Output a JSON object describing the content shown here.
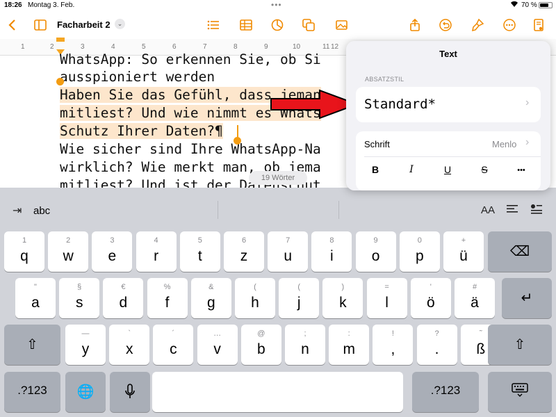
{
  "status": {
    "time": "18:26",
    "date": "Montag 3. Feb.",
    "battery": "70 %"
  },
  "toolbar": {
    "doc_title": "Facharbeit 2",
    "title_menu": "⌄"
  },
  "ruler": {
    "numbers": [
      "1",
      "2",
      "3",
      "4",
      "5",
      "6",
      "7",
      "8",
      "9",
      "10",
      "11",
      "12"
    ]
  },
  "document": {
    "lines": [
      "WhatsApp: So erkennen Sie, ob Si",
      "ausspioniert werden",
      "Haben Sie das Gefühl, dass jeman",
      "mitliest? Und wie nimmt es Whats",
      "Schutz Ihrer Daten?¶",
      "Wie sicher sind Ihre WhatsApp-Na",
      "wirklich? Wie merkt man, ob jema",
      "mitliest? Und ist der Datenschut"
    ],
    "word_count": "19 Wörter"
  },
  "panel": {
    "title": "Text",
    "section_label": "ABSATZSTIL",
    "paragraph_style": "Standard*",
    "font_label": "Schrift",
    "font_value": "Menlo",
    "format": {
      "bold": "B",
      "italic": "I",
      "underline": "U",
      "strike": "S",
      "more": "•••"
    }
  },
  "keyboard": {
    "suggest_left": "abc",
    "text_size": "AA",
    "row1": [
      {
        "main": "q",
        "sub": "1"
      },
      {
        "main": "w",
        "sub": "2"
      },
      {
        "main": "e",
        "sub": "3"
      },
      {
        "main": "r",
        "sub": "4"
      },
      {
        "main": "t",
        "sub": "5"
      },
      {
        "main": "z",
        "sub": "6"
      },
      {
        "main": "u",
        "sub": "7"
      },
      {
        "main": "i",
        "sub": "8"
      },
      {
        "main": "o",
        "sub": "9"
      },
      {
        "main": "p",
        "sub": "0"
      },
      {
        "main": "ü",
        "sub": "+"
      }
    ],
    "row2": [
      {
        "main": "a",
        "sub": "\""
      },
      {
        "main": "s",
        "sub": "§"
      },
      {
        "main": "d",
        "sub": "€"
      },
      {
        "main": "f",
        "sub": "%"
      },
      {
        "main": "g",
        "sub": "&"
      },
      {
        "main": "h",
        "sub": "("
      },
      {
        "main": "j",
        "sub": "("
      },
      {
        "main": "k",
        "sub": ")"
      },
      {
        "main": "l",
        "sub": "="
      },
      {
        "main": "ö",
        "sub": "'"
      },
      {
        "main": "ä",
        "sub": "#"
      }
    ],
    "row3": [
      {
        "main": "y",
        "sub": "—"
      },
      {
        "main": "x",
        "sub": "`"
      },
      {
        "main": "c",
        "sub": "´"
      },
      {
        "main": "v",
        "sub": "…"
      },
      {
        "main": "b",
        "sub": "@"
      },
      {
        "main": "n",
        "sub": ";"
      },
      {
        "main": "m",
        "sub": ":"
      },
      {
        "main": ",",
        "sub": "!"
      },
      {
        "main": ".",
        "sub": "?"
      },
      {
        "main": "ß",
        "sub": "˜"
      }
    ],
    "numbers_key": ".?123",
    "numbers_key_right": ".?123"
  },
  "colors": {
    "accent": "#f08a00",
    "selection": "#fde6cc",
    "arrow": "#e8141b"
  }
}
